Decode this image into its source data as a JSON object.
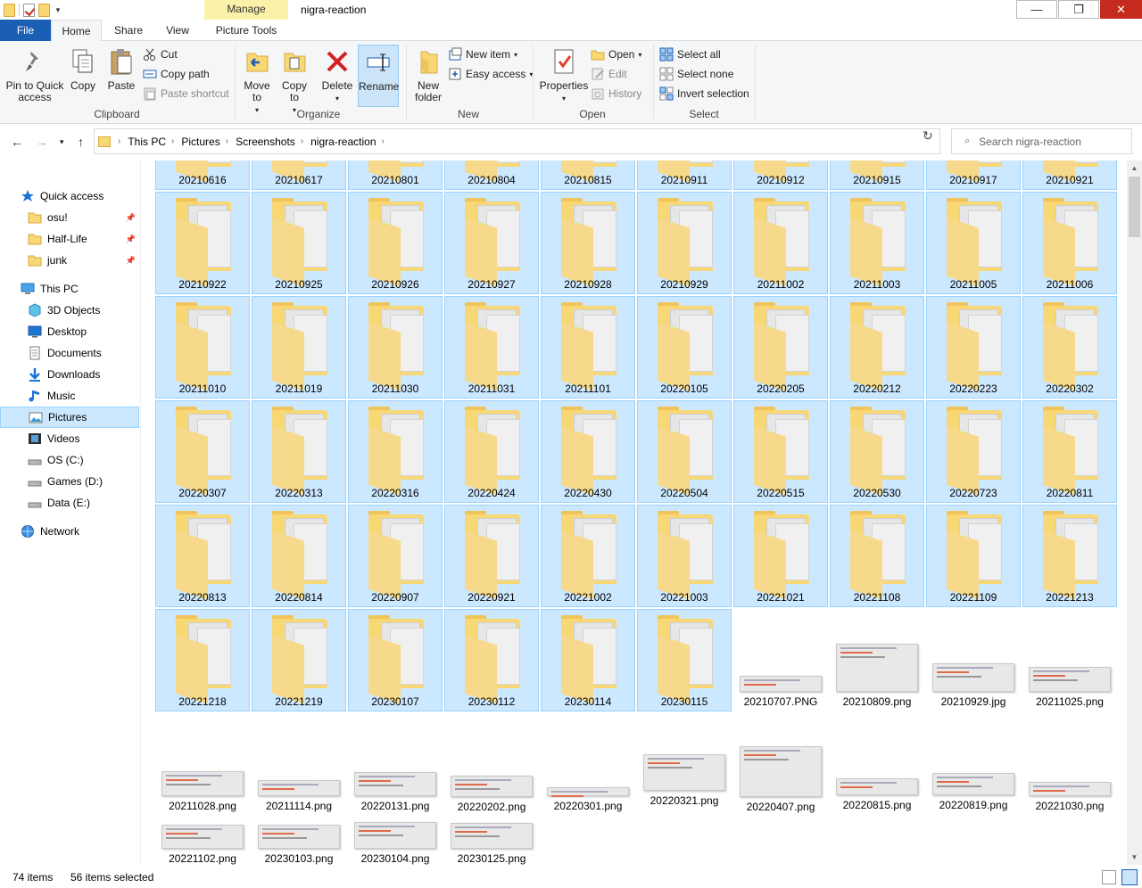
{
  "window": {
    "title": "nigra-reaction",
    "contextual_tab": "Manage",
    "colors": {
      "accent": "#1a5fb4",
      "selection": "#cce8ff",
      "selection_border": "#99d1ff",
      "close": "#c42b1c",
      "folder": "#f8d775"
    }
  },
  "ribbon_tabs": {
    "file": "File",
    "home": "Home",
    "share": "Share",
    "view": "View",
    "picture_tools": "Picture Tools"
  },
  "ribbon": {
    "clipboard": {
      "label": "Clipboard",
      "pin": "Pin to Quick access",
      "copy": "Copy",
      "paste": "Paste",
      "cut": "Cut",
      "copy_path": "Copy path",
      "paste_shortcut": "Paste shortcut"
    },
    "organize": {
      "label": "Organize",
      "move_to": "Move to",
      "copy_to": "Copy to",
      "delete": "Delete",
      "rename": "Rename"
    },
    "new": {
      "label": "New",
      "new_folder": "New folder",
      "new_item": "New item",
      "easy_access": "Easy access"
    },
    "open": {
      "label": "Open",
      "properties": "Properties",
      "open": "Open",
      "edit": "Edit",
      "history": "History"
    },
    "select": {
      "label": "Select",
      "select_all": "Select all",
      "select_none": "Select none",
      "invert": "Invert selection"
    }
  },
  "address": {
    "crumbs": [
      "This PC",
      "Pictures",
      "Screenshots",
      "nigra-reaction"
    ],
    "search_placeholder": "Search nigra-reaction"
  },
  "nav": {
    "items": [
      {
        "label": "Quick access",
        "icon": "star-icon",
        "level": 0,
        "pinned": false
      },
      {
        "label": "osu!",
        "icon": "folder-icon",
        "level": 1,
        "pinned": true
      },
      {
        "label": "Half-Life",
        "icon": "folder-icon",
        "level": 1,
        "pinned": true
      },
      {
        "label": "junk",
        "icon": "folder-icon",
        "level": 1,
        "pinned": true
      },
      {
        "label": "This PC",
        "icon": "computer-icon",
        "level": 0,
        "pinned": false
      },
      {
        "label": "3D Objects",
        "icon": "cube-icon",
        "level": 1,
        "pinned": false
      },
      {
        "label": "Desktop",
        "icon": "desktop-icon",
        "level": 1,
        "pinned": false
      },
      {
        "label": "Documents",
        "icon": "document-icon",
        "level": 1,
        "pinned": false
      },
      {
        "label": "Downloads",
        "icon": "download-icon",
        "level": 1,
        "pinned": false
      },
      {
        "label": "Music",
        "icon": "music-icon",
        "level": 1,
        "pinned": false
      },
      {
        "label": "Pictures",
        "icon": "pictures-icon",
        "level": 1,
        "pinned": false,
        "selected": true
      },
      {
        "label": "Videos",
        "icon": "video-icon",
        "level": 1,
        "pinned": false
      },
      {
        "label": "OS (C:)",
        "icon": "drive-icon",
        "level": 1,
        "pinned": false
      },
      {
        "label": "Games (D:)",
        "icon": "drive-icon",
        "level": 1,
        "pinned": false
      },
      {
        "label": "Data (E:)",
        "icon": "drive-icon",
        "level": 1,
        "pinned": false
      },
      {
        "label": "Network",
        "icon": "network-icon",
        "level": 0,
        "pinned": false
      }
    ]
  },
  "folders": [
    "20210616",
    "20210617",
    "20210801",
    "20210804",
    "20210815",
    "20210911",
    "20210912",
    "20210915",
    "20210917",
    "20210921",
    "20210922",
    "20210925",
    "20210926",
    "20210927",
    "20210928",
    "20210929",
    "20211002",
    "20211003",
    "20211005",
    "20211006",
    "20211010",
    "20211019",
    "20211030",
    "20211031",
    "20211101",
    "20220105",
    "20220205",
    "20220212",
    "20220223",
    "20220302",
    "20220307",
    "20220313",
    "20220316",
    "20220424",
    "20220430",
    "20220504",
    "20220515",
    "20220530",
    "20220723",
    "20220811",
    "20220813",
    "20220814",
    "20220907",
    "20220921",
    "20221002",
    "20221003",
    "20221021",
    "20221108",
    "20221109",
    "20221213",
    "20221218",
    "20221219",
    "20230107",
    "20230112",
    "20230114",
    "20230115"
  ],
  "files": [
    "20210707.PNG",
    "20210809.png",
    "20210929.jpg",
    "20211025.png",
    "20211028.png",
    "20211114.png",
    "20220131.png",
    "20220202.png",
    "20220301.png",
    "20220321.png",
    "20220407.png",
    "20220815.png",
    "20220819.png",
    "20221030.png",
    "20221102.png",
    "20230103.png",
    "20230104.png",
    "20230125.png"
  ],
  "status": {
    "count": "74 items",
    "selected": "56 items selected"
  }
}
